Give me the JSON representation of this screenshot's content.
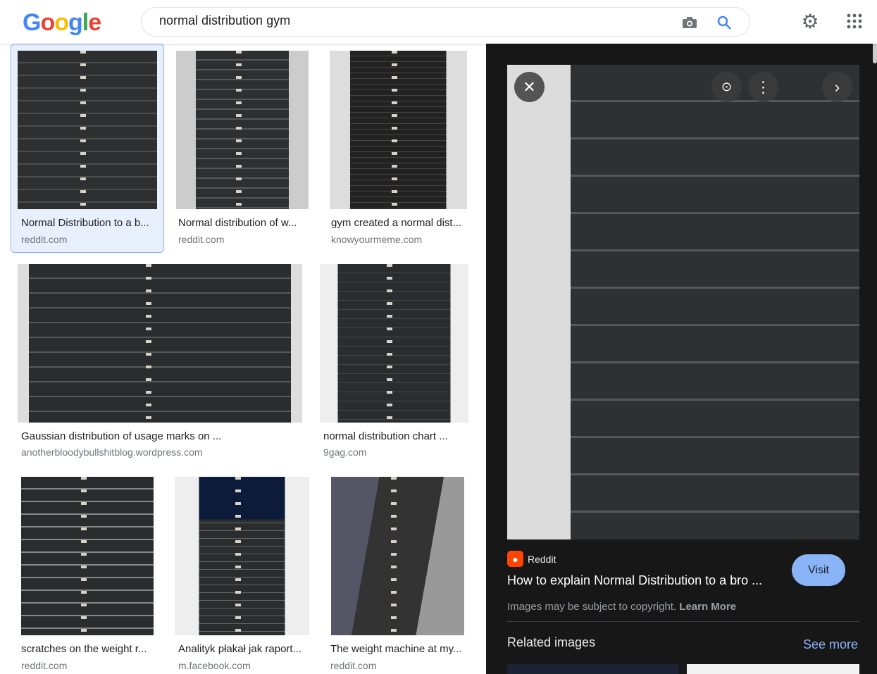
{
  "header": {
    "logo": "Google",
    "query": "normal distribution gym",
    "icons": [
      "camera-icon",
      "search-icon",
      "gear-icon",
      "apps-grid-icon"
    ]
  },
  "results": [
    {
      "title": "Normal Distribution to a b...",
      "source": "reddit.com"
    },
    {
      "title": "Normal distribution of w...",
      "source": "reddit.com"
    },
    {
      "title": "gym created a normal dist...",
      "source": "knowyourmeme.com"
    },
    {
      "title": "Gaussian distribution of usage marks on ...",
      "source": "anotherbloodybullshitblog.wordpress.com"
    },
    {
      "title": "normal distribution chart ...",
      "source": "9gag.com"
    },
    {
      "title": "scratches on the weight r...",
      "source": "reddit.com"
    },
    {
      "title": "Analityk płakał jak raport...",
      "source": "m.facebook.com"
    },
    {
      "title": "The weight machine at my...",
      "source": "reddit.com"
    }
  ],
  "panel": {
    "site": "Reddit",
    "title": "How to explain Normal Distribution to a bro ...",
    "visit": "Visit",
    "copyright": "Images may be subject to copyright.",
    "learn_more": "Learn More",
    "related": "Related images",
    "see_more": "See more",
    "accent": "#8ab4f8"
  }
}
